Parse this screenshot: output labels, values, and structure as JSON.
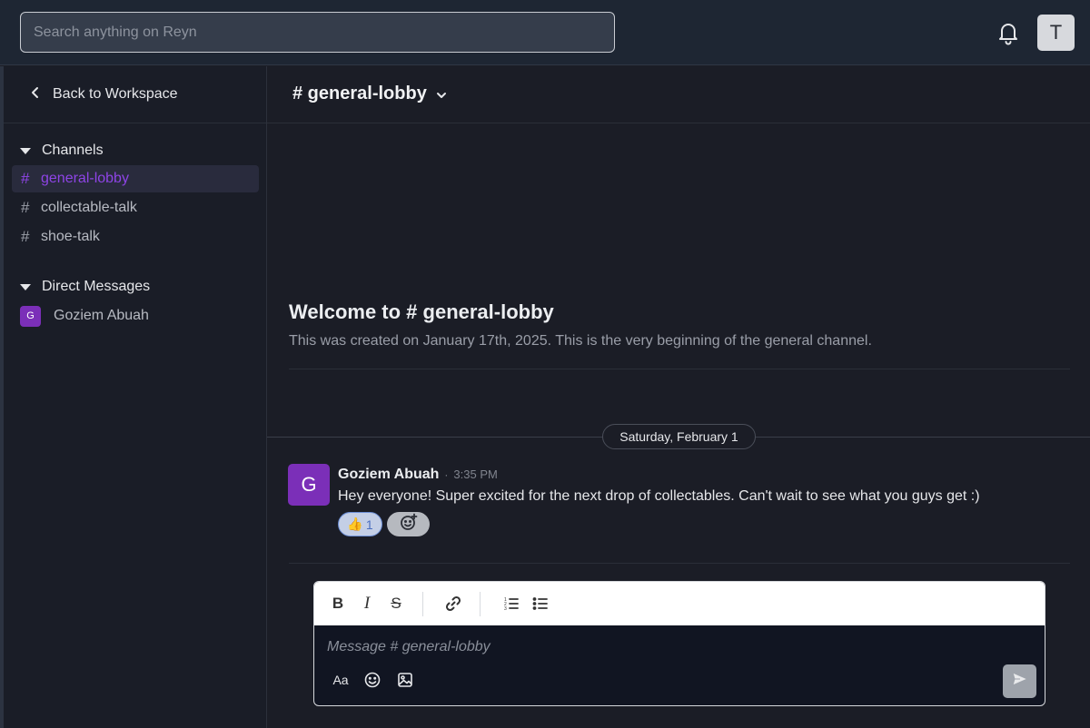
{
  "search": {
    "placeholder": "Search anything on Reyn"
  },
  "user": {
    "initial": "T"
  },
  "sidebar": {
    "back_label": "Back to Workspace",
    "channels_heading": "Channels",
    "channels": [
      {
        "hash": "#",
        "label": "general-lobby",
        "active": true
      },
      {
        "hash": "#",
        "label": "collectable-talk",
        "active": false
      },
      {
        "hash": "#",
        "label": "shoe-talk",
        "active": false
      }
    ],
    "dm_heading": "Direct Messages",
    "dms": [
      {
        "initial": "G",
        "label": "Goziem Abuah"
      }
    ]
  },
  "channel": {
    "title": "# general-lobby",
    "welcome_title": "Welcome to # general-lobby",
    "welcome_sub": "This was created on January 17th, 2025. This is the very beginning of the general channel."
  },
  "date_divider": "Saturday, February 1",
  "message": {
    "initial": "G",
    "author": "Goziem Abuah",
    "dot": "·",
    "time": "3:35 PM",
    "text": "Hey everyone! Super excited for the next drop of collectables. Can't wait to see what you guys get :)",
    "reaction": {
      "emoji": "👍",
      "count": "1"
    }
  },
  "composer": {
    "placeholder": "Message # general-lobby",
    "bold": "B",
    "italic": "I",
    "strike": "S",
    "format_label": "Aa"
  },
  "colors": {
    "accent": "#8e44e6",
    "avatar": "#7b2fb8"
  }
}
